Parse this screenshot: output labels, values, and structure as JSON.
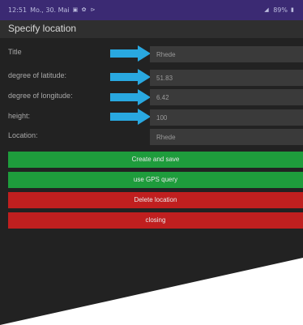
{
  "status_bar": {
    "time": "12:51",
    "date": "Mo., 30. Mai",
    "battery": "89%",
    "bar_color": "#3b2a73",
    "icons_left": [
      "image-icon",
      "settings-icon",
      "cast-icon"
    ],
    "icons_right": [
      "signal-icon",
      "battery-icon"
    ]
  },
  "title_bar": {
    "title": "Specify location"
  },
  "form": {
    "rows": [
      {
        "label": "Title",
        "value": "Rhede",
        "has_arrow": true
      },
      {
        "label": "degree of latitude:",
        "value": "51.83",
        "has_arrow": true
      },
      {
        "label": "degree of longitude:",
        "value": "6.42",
        "has_arrow": true
      },
      {
        "label": "height:",
        "value": "100",
        "has_arrow": true
      },
      {
        "label": "Location:",
        "value": "Rhede",
        "has_arrow": false
      }
    ],
    "arrow_color": "#29a8e0"
  },
  "buttons": {
    "create_label": "Create and save",
    "gps_label": "use GPS query",
    "delete_label": "Delete location",
    "close_label": "closing",
    "green_color": "#1e9c3c",
    "red_color": "#c01f1f"
  }
}
